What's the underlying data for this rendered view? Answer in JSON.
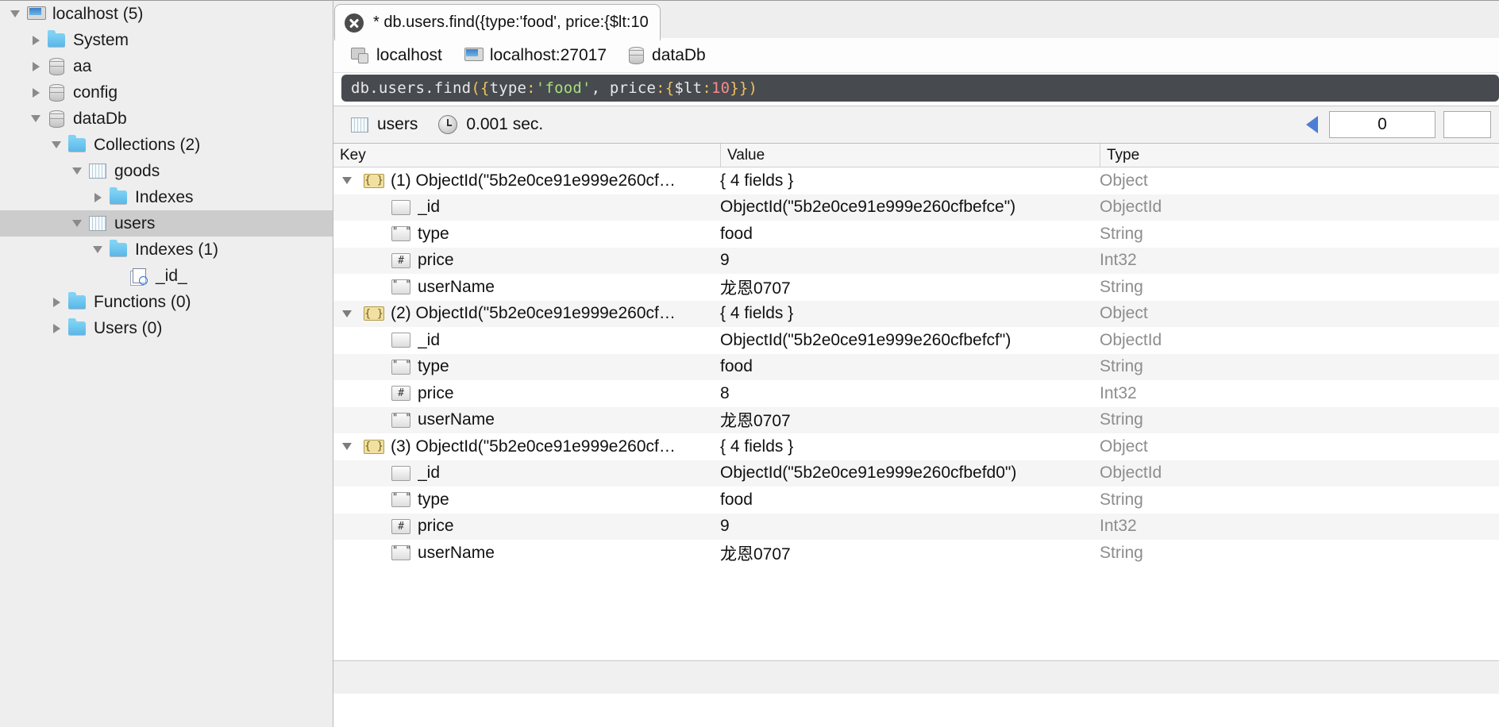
{
  "sidebar": {
    "items": [
      {
        "label": "localhost (5)",
        "icon": "monitor-icon",
        "state": "open",
        "indent": 0,
        "selected": false
      },
      {
        "label": "System",
        "icon": "folder-icon",
        "state": "closed",
        "indent": 1,
        "selected": false
      },
      {
        "label": "aa",
        "icon": "database-icon",
        "state": "closed",
        "indent": 1,
        "selected": false
      },
      {
        "label": "config",
        "icon": "database-icon",
        "state": "closed",
        "indent": 1,
        "selected": false
      },
      {
        "label": "dataDb",
        "icon": "database-icon",
        "state": "open",
        "indent": 1,
        "selected": false
      },
      {
        "label": "Collections (2)",
        "icon": "folder-icon",
        "state": "open",
        "indent": 2,
        "selected": false
      },
      {
        "label": "goods",
        "icon": "collection-icon",
        "state": "open",
        "indent": 3,
        "selected": false
      },
      {
        "label": "Indexes",
        "icon": "folder-icon",
        "state": "closed",
        "indent": 4,
        "selected": false
      },
      {
        "label": "users",
        "icon": "collection-icon",
        "state": "open",
        "indent": 3,
        "selected": true
      },
      {
        "label": "Indexes (1)",
        "icon": "folder-icon",
        "state": "open",
        "indent": 4,
        "selected": false
      },
      {
        "label": "_id_",
        "icon": "index-icon",
        "state": "none",
        "indent": 5,
        "selected": false
      },
      {
        "label": "Functions (0)",
        "icon": "folder-icon",
        "state": "closed",
        "indent": 2,
        "selected": false
      },
      {
        "label": "Users (0)",
        "icon": "folder-icon",
        "state": "closed",
        "indent": 2,
        "selected": false
      }
    ]
  },
  "tab": {
    "close_icon": "close-icon",
    "title": "* db.users.find({type:'food', price:{$lt:10"
  },
  "breadcrumb": [
    {
      "label": "localhost",
      "icon": "server-icon"
    },
    {
      "label": "localhost:27017",
      "icon": "monitor-icon"
    },
    {
      "label": "dataDb",
      "icon": "database-icon"
    }
  ],
  "query_editor": {
    "tokens": [
      {
        "text": "db.users.find",
        "color": "#e8e8e8"
      },
      {
        "text": "(",
        "color": "#f0c060"
      },
      {
        "text": "{",
        "color": "#f0c060"
      },
      {
        "text": "type",
        "color": "#e8e8e8"
      },
      {
        "text": ":",
        "color": "#f0c060"
      },
      {
        "text": "'food'",
        "color": "#a8de7c"
      },
      {
        "text": ", ",
        "color": "#e8e8e8"
      },
      {
        "text": "price",
        "color": "#e8e8e8"
      },
      {
        "text": ":",
        "color": "#f0c060"
      },
      {
        "text": "{",
        "color": "#f0c060"
      },
      {
        "text": "$lt",
        "color": "#e8e8e8"
      },
      {
        "text": ":",
        "color": "#f0c060"
      },
      {
        "text": "10",
        "color": "#f58b8b"
      },
      {
        "text": "}",
        "color": "#f0c060"
      },
      {
        "text": "}",
        "color": "#f0c060"
      },
      {
        "text": ")",
        "color": "#f0c060"
      }
    ],
    "background": "#474b4f"
  },
  "status": {
    "collection_icon": "collection-icon",
    "collection": "users",
    "clock_icon": "clock-icon",
    "time": "0.001 sec.",
    "prev_arrow_icon": "left-arrow-icon",
    "skip_value": "0",
    "limit_value": ""
  },
  "table": {
    "headers": {
      "key": "Key",
      "value": "Value",
      "type": "Type"
    },
    "rows": [
      {
        "key": "(1) ObjectId(\"5b2e0ce91e999e260cf…",
        "value": "{ 4 fields }",
        "type": "Object",
        "icon": "object-icon",
        "level": 0,
        "expanded": true,
        "alt": false
      },
      {
        "key": "_id",
        "value": "ObjectId(\"5b2e0ce91e999e260cfbefce\")",
        "type": "ObjectId",
        "icon": "objectid-icon",
        "level": 1,
        "expanded": false,
        "alt": true
      },
      {
        "key": "type",
        "value": "food",
        "type": "String",
        "icon": "string-icon",
        "level": 1,
        "expanded": false,
        "alt": false
      },
      {
        "key": "price",
        "value": "9",
        "type": "Int32",
        "icon": "int-icon",
        "level": 1,
        "expanded": false,
        "alt": true
      },
      {
        "key": "userName",
        "value": "龙恩0707",
        "type": "String",
        "icon": "string-icon",
        "level": 1,
        "expanded": false,
        "alt": false
      },
      {
        "key": "(2) ObjectId(\"5b2e0ce91e999e260cf…",
        "value": "{ 4 fields }",
        "type": "Object",
        "icon": "object-icon",
        "level": 0,
        "expanded": true,
        "alt": true
      },
      {
        "key": "_id",
        "value": "ObjectId(\"5b2e0ce91e999e260cfbefcf\")",
        "type": "ObjectId",
        "icon": "objectid-icon",
        "level": 1,
        "expanded": false,
        "alt": false
      },
      {
        "key": "type",
        "value": "food",
        "type": "String",
        "icon": "string-icon",
        "level": 1,
        "expanded": false,
        "alt": true
      },
      {
        "key": "price",
        "value": "8",
        "type": "Int32",
        "icon": "int-icon",
        "level": 1,
        "expanded": false,
        "alt": false
      },
      {
        "key": "userName",
        "value": "龙恩0707",
        "type": "String",
        "icon": "string-icon",
        "level": 1,
        "expanded": false,
        "alt": true
      },
      {
        "key": "(3) ObjectId(\"5b2e0ce91e999e260cf…",
        "value": "{ 4 fields }",
        "type": "Object",
        "icon": "object-icon",
        "level": 0,
        "expanded": true,
        "alt": false
      },
      {
        "key": "_id",
        "value": "ObjectId(\"5b2e0ce91e999e260cfbefd0\")",
        "type": "ObjectId",
        "icon": "objectid-icon",
        "level": 1,
        "expanded": false,
        "alt": true
      },
      {
        "key": "type",
        "value": "food",
        "type": "String",
        "icon": "string-icon",
        "level": 1,
        "expanded": false,
        "alt": false
      },
      {
        "key": "price",
        "value": "9",
        "type": "Int32",
        "icon": "int-icon",
        "level": 1,
        "expanded": false,
        "alt": true
      },
      {
        "key": "userName",
        "value": "龙恩0707",
        "type": "String",
        "icon": "string-icon",
        "level": 1,
        "expanded": false,
        "alt": false
      }
    ]
  }
}
